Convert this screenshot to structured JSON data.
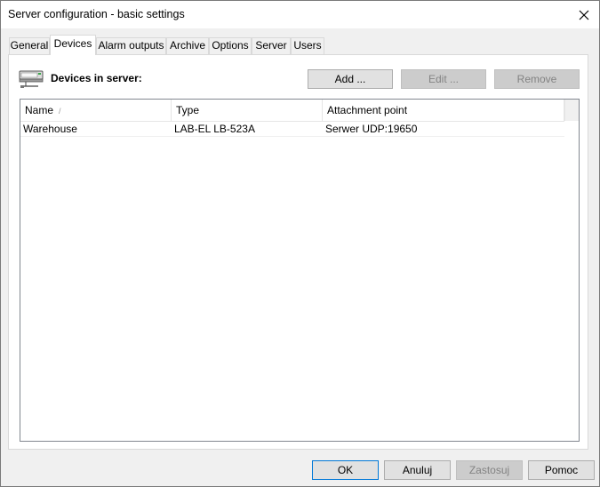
{
  "window": {
    "title": "Server configuration - basic settings"
  },
  "tabs": [
    {
      "label": "General"
    },
    {
      "label": "Devices"
    },
    {
      "label": "Alarm outputs"
    },
    {
      "label": "Archive"
    },
    {
      "label": "Options"
    },
    {
      "label": "Server"
    },
    {
      "label": "Users"
    }
  ],
  "active_tab": "Devices",
  "devices_panel": {
    "heading": "Devices in server:",
    "add_label": "Add ...",
    "edit_label": "Edit ...",
    "remove_label": "Remove",
    "columns": [
      "Name",
      "Type",
      "Attachment point"
    ],
    "sort_glyph": "/",
    "rows": [
      {
        "name": "Warehouse",
        "type": "LAB-EL LB-523A",
        "attachment": "Serwer UDP:19650"
      }
    ]
  },
  "footer": {
    "ok_label": "OK",
    "cancel_label": "Anuluj",
    "apply_label": "Zastosuj",
    "help_label": "Pomoc"
  },
  "icons": {
    "close": "close-icon",
    "device": "server-device-icon"
  }
}
